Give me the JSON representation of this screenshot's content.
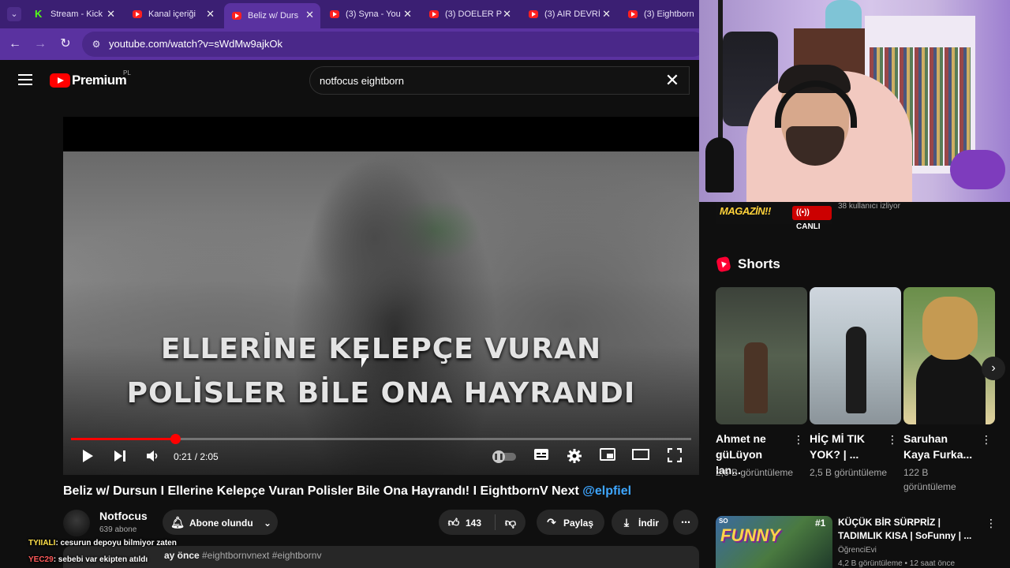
{
  "browser": {
    "tabs": [
      {
        "title": "Stream - Kick",
        "icon": "kick-icon"
      },
      {
        "title": "Kanal içeriği",
        "icon": "youtube-icon"
      },
      {
        "title": "Beliz w/ Durs",
        "icon": "youtube-icon",
        "active": true
      },
      {
        "title": "(3) Syna - You",
        "icon": "youtube-icon"
      },
      {
        "title": "(3) DOELER P",
        "icon": "youtube-icon"
      },
      {
        "title": "(3) AIR DEVRİ",
        "icon": "youtube-icon"
      },
      {
        "title": "(3) Eightborn",
        "icon": "youtube-icon"
      }
    ],
    "url": "youtube.com/watch?v=sWdMw9ajkOk",
    "colors": {
      "tabbar": "#3b1f73",
      "toolbar": "#5a32a0"
    }
  },
  "youtube": {
    "brand": "Premium",
    "region": "PL",
    "search_value": "notfocus eightborn"
  },
  "player": {
    "subtitle_line1": "ELLERİNE KELEPÇE VURAN",
    "subtitle_line2": "POLİSLER BİLE ONA HAYRANDI",
    "time": "0:21 / 2:05",
    "progress": 0.168
  },
  "video": {
    "title": "Beliz w/ Dursun I Ellerine Kelepçe Vuran Polisler Bile Ona Hayrandı! I EightbornV Next",
    "mention": "@elpfiel",
    "channel": "Notfocus",
    "subscribers": "639 abone",
    "subscribe_label": "Abone olundu",
    "likes": "143",
    "share_label": "Paylaş",
    "download_label": "İndir",
    "description_time": "ay önce",
    "description_tags": "#eightbornvnext #eightbornv"
  },
  "chat_overlay": [
    {
      "user": "TYIIALI",
      "message": ": cesurun depoyu bilmiyor zaten"
    },
    {
      "user": "YEC29",
      "message": ": sebebi var ekipten atıldı"
    }
  ],
  "stream": {
    "banner_logo": "MAGAZİN!!",
    "live_label": "CANLI",
    "watching": "38 kullanıcı izliyor"
  },
  "shorts": {
    "section_title": "Shorts",
    "items": [
      {
        "title": "Ahmet ne güLüyon lan...",
        "views": "2,6 B görüntüleme"
      },
      {
        "title": "HİÇ Mİ TIK YOK? | ...",
        "views": "2,5 B görüntüleme"
      },
      {
        "title": "Saruhan Kaya  Furka...",
        "views": "122 B görüntüleme"
      }
    ]
  },
  "recommendation": {
    "title": "KÜÇÜK BİR SÜRPRİZ | TADIMLIK KISA | SoFunny | ...",
    "channel": "ÖğrenciEvi",
    "meta": "4,2 B görüntüleme • 12 saat önce",
    "thumb_word": "FUNNY",
    "thumb_tag": "SO",
    "thumb_rank": "#1"
  }
}
